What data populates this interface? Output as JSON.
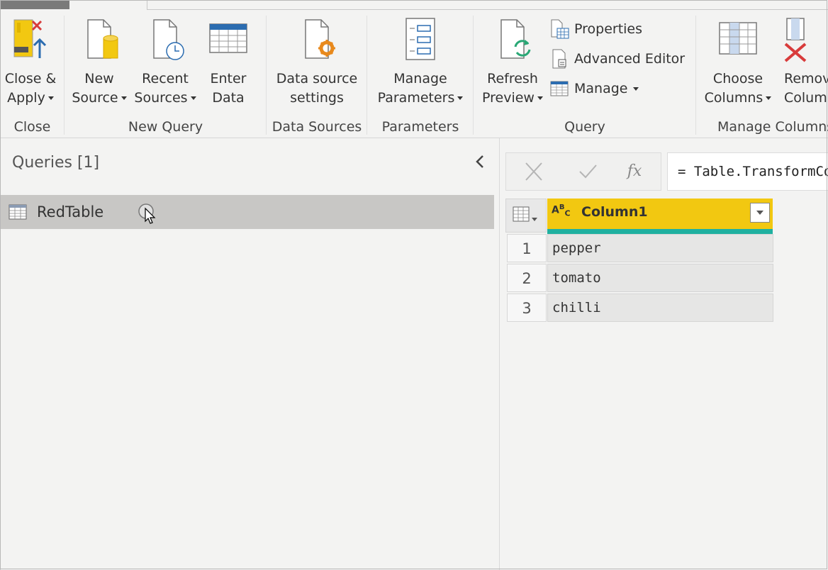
{
  "ribbon": {
    "close": {
      "close_apply": [
        "Close &",
        "Apply"
      ],
      "label": "Close"
    },
    "new_query": {
      "new_source": [
        "New",
        "Source"
      ],
      "recent_sources": [
        "Recent",
        "Sources"
      ],
      "enter_data": [
        "Enter",
        "Data"
      ],
      "label": "New Query"
    },
    "data_sources": {
      "settings": [
        "Data source",
        "settings"
      ],
      "label": "Data Sources"
    },
    "parameters": {
      "manage": [
        "Manage",
        "Parameters"
      ],
      "label": "Parameters"
    },
    "query": {
      "refresh": [
        "Refresh",
        "Preview"
      ],
      "properties": "Properties",
      "advanced_editor": "Advanced Editor",
      "manage": "Manage",
      "label": "Query"
    },
    "manage_columns": {
      "choose": [
        "Choose",
        "Columns"
      ],
      "remove": [
        "Remove",
        "Columns"
      ],
      "label": "Manage Columns"
    }
  },
  "queries_panel": {
    "title": "Queries [1]",
    "items": [
      {
        "label": "RedTable"
      }
    ]
  },
  "formula_bar": {
    "formula": "= Table.TransformColumnTypes"
  },
  "table": {
    "type_badge": "ABC",
    "columns": [
      "Column1"
    ],
    "rows": [
      {
        "n": "1",
        "value": "pepper"
      },
      {
        "n": "2",
        "value": "tomato"
      },
      {
        "n": "3",
        "value": "chilli"
      }
    ]
  },
  "colors": {
    "accent_yellow": "#f2c811",
    "quality_bar": "#1fb0a0",
    "selected_query": "#c8c7c5"
  }
}
